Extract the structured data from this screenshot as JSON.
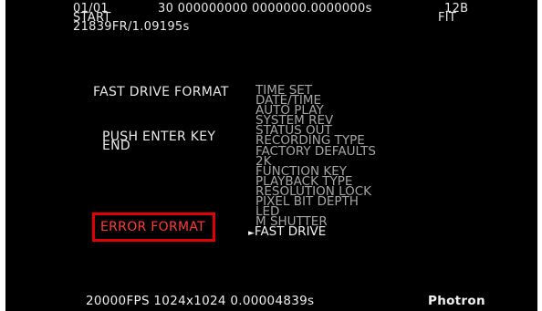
{
  "status": {
    "frame_counter": "01/01",
    "trigger_label": "START",
    "frame_time": "21839FR/1.09195s",
    "top_numbers": "30 000000000 0000000.0000000s",
    "bit_depth": "12B",
    "fit_label": "FIT"
  },
  "panel": {
    "title": "FAST DRIVE FORMAT",
    "instruction_line1": "PUSH ENTER KEY",
    "instruction_line2": "END",
    "error_label": "ERROR FORMAT"
  },
  "menu": {
    "items": [
      "TIME SET",
      "DATE/TIME",
      "AUTO PLAY",
      "SYSTEM REV",
      "STATUS OUT",
      "RECORDING TYPE",
      "FACTORY DEFAULTS",
      "2K",
      "FUNCTION KEY",
      "PLAYBACK TYPE",
      "RESOLUTION LOCK",
      "PIXEL BIT DEPTH",
      "LED",
      "M SHUTTER",
      "FAST DRIVE"
    ],
    "selected_index": 14,
    "cursor_glyph": "►"
  },
  "footer": {
    "info": "20000FPS 1024x1024 0.00004839s",
    "brand": "Photron"
  },
  "colors": {
    "background": "#000000",
    "text": "#e8e8e8",
    "menu_dim": "#a6a6a6",
    "error_red": "#e00000"
  }
}
